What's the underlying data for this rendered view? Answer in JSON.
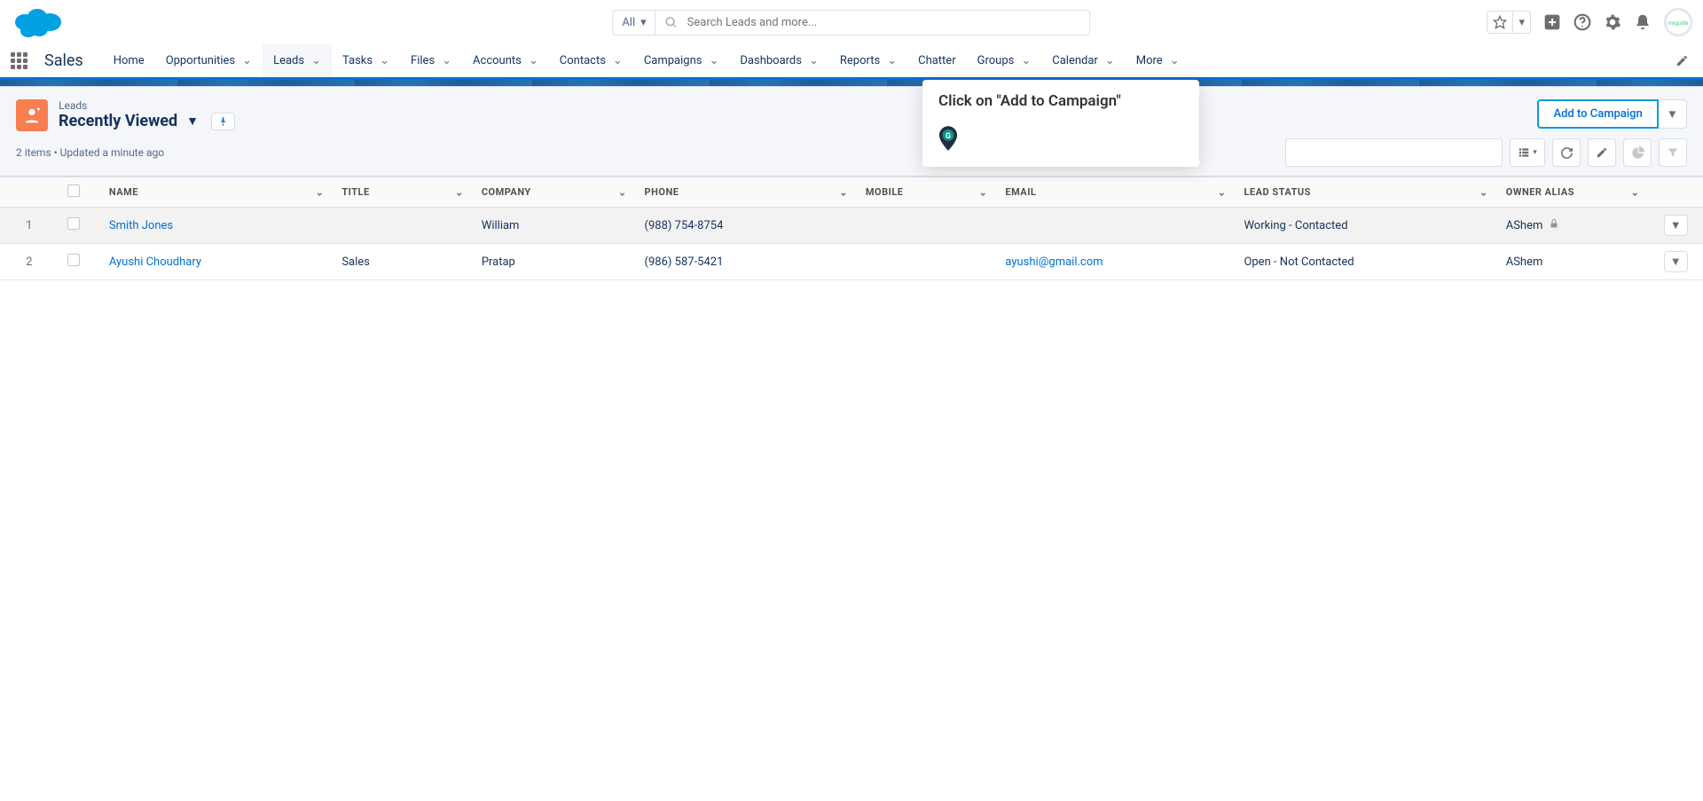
{
  "header": {
    "search_scope": "All",
    "search_placeholder": "Search Leads and more..."
  },
  "nav": {
    "app_name": "Sales",
    "items": [
      "Home",
      "Opportunities",
      "Leads",
      "Tasks",
      "Files",
      "Accounts",
      "Contacts",
      "Campaigns",
      "Dashboards",
      "Reports",
      "Chatter",
      "Groups",
      "Calendar",
      "More"
    ],
    "active": "Leads"
  },
  "page": {
    "object_label": "Leads",
    "listview_title": "Recently Viewed",
    "status": "2 items • Updated a minute ago",
    "primary_action": "Add to Campaign"
  },
  "tooltip": {
    "text": "Click on \"Add to Campaign\""
  },
  "table": {
    "columns": [
      "NAME",
      "TITLE",
      "COMPANY",
      "PHONE",
      "MOBILE",
      "EMAIL",
      "LEAD STATUS",
      "OWNER ALIAS"
    ],
    "rows": [
      {
        "num": "1",
        "name": "Smith Jones",
        "title": "",
        "company": "William",
        "phone": "(988) 754-8754",
        "mobile": "",
        "email": "",
        "lead_status": "Working - Contacted",
        "owner_alias": "AShem",
        "locked": true
      },
      {
        "num": "2",
        "name": "Ayushi Choudhary",
        "title": "Sales",
        "company": "Pratap",
        "phone": "(986) 587-5421",
        "mobile": "",
        "email": "ayushi@gmail.com",
        "lead_status": "Open - Not Contacted",
        "owner_alias": "AShem",
        "locked": false
      }
    ]
  }
}
